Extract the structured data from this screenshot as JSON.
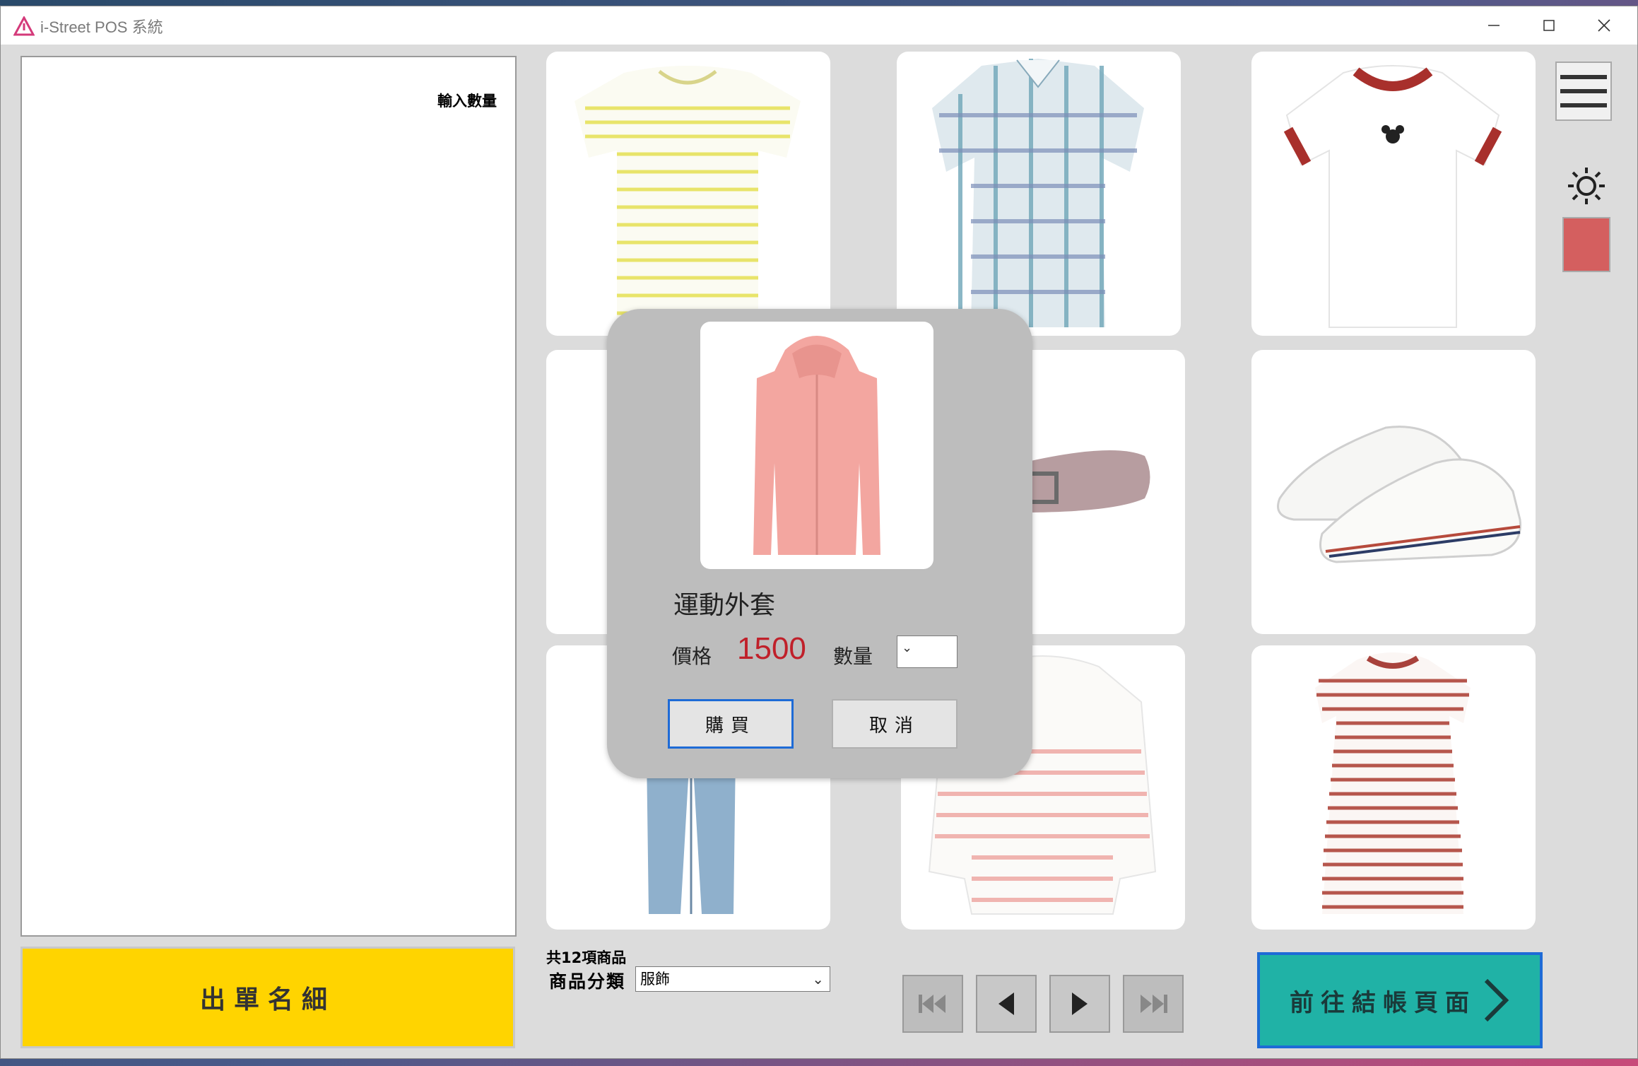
{
  "window": {
    "title": "i-Street POS 系統",
    "icons": {
      "app": "warning-triangle-icon",
      "minimize": "minimize-icon",
      "maximize": "maximize-icon",
      "close": "close-icon"
    }
  },
  "order_panel": {
    "qty_label": "輸入數量",
    "order_button_label": "出單名細"
  },
  "products": [
    {
      "name": "yellow-striped-tshirt",
      "image": "yellow-striped-tshirt"
    },
    {
      "name": "plaid-shirt",
      "image": "blue-plaid-shirt"
    },
    {
      "name": "mickey-ringer-tshirt",
      "image": "white-red-ringer-tshirt"
    },
    {
      "name": "hidden-product",
      "image": "hidden"
    },
    {
      "name": "belt",
      "image": "mauve-belt"
    },
    {
      "name": "canvas-sneakers",
      "image": "white-sneakers"
    },
    {
      "name": "jeans",
      "image": "blue-jeans"
    },
    {
      "name": "striped-sweater",
      "image": "pink-striped-sweater"
    },
    {
      "name": "striped-dress",
      "image": "red-striped-dress"
    }
  ],
  "footer": {
    "total_count": "共12項商品",
    "category_label": "商品分類",
    "category_value": "服飾",
    "pager_icons": [
      "first-page-icon",
      "prev-page-icon",
      "next-page-icon",
      "last-page-icon"
    ],
    "checkout_label": "前往結帳頁面"
  },
  "side_tools": {
    "menu_icon": "hamburger-menu-icon",
    "brightness_icon": "brightness-icon",
    "theme_color": "#d45f5f"
  },
  "modal": {
    "product_name": "運動外套",
    "price_label": "價格",
    "price_value": "1500",
    "qty_label": "數量",
    "buy_label": "購買",
    "cancel_label": "取消",
    "price_color": "#c0202a"
  },
  "colors": {
    "order_button": "#ffd400",
    "checkout_button": "#20b2a6",
    "focus_border": "#1e6bd6"
  }
}
